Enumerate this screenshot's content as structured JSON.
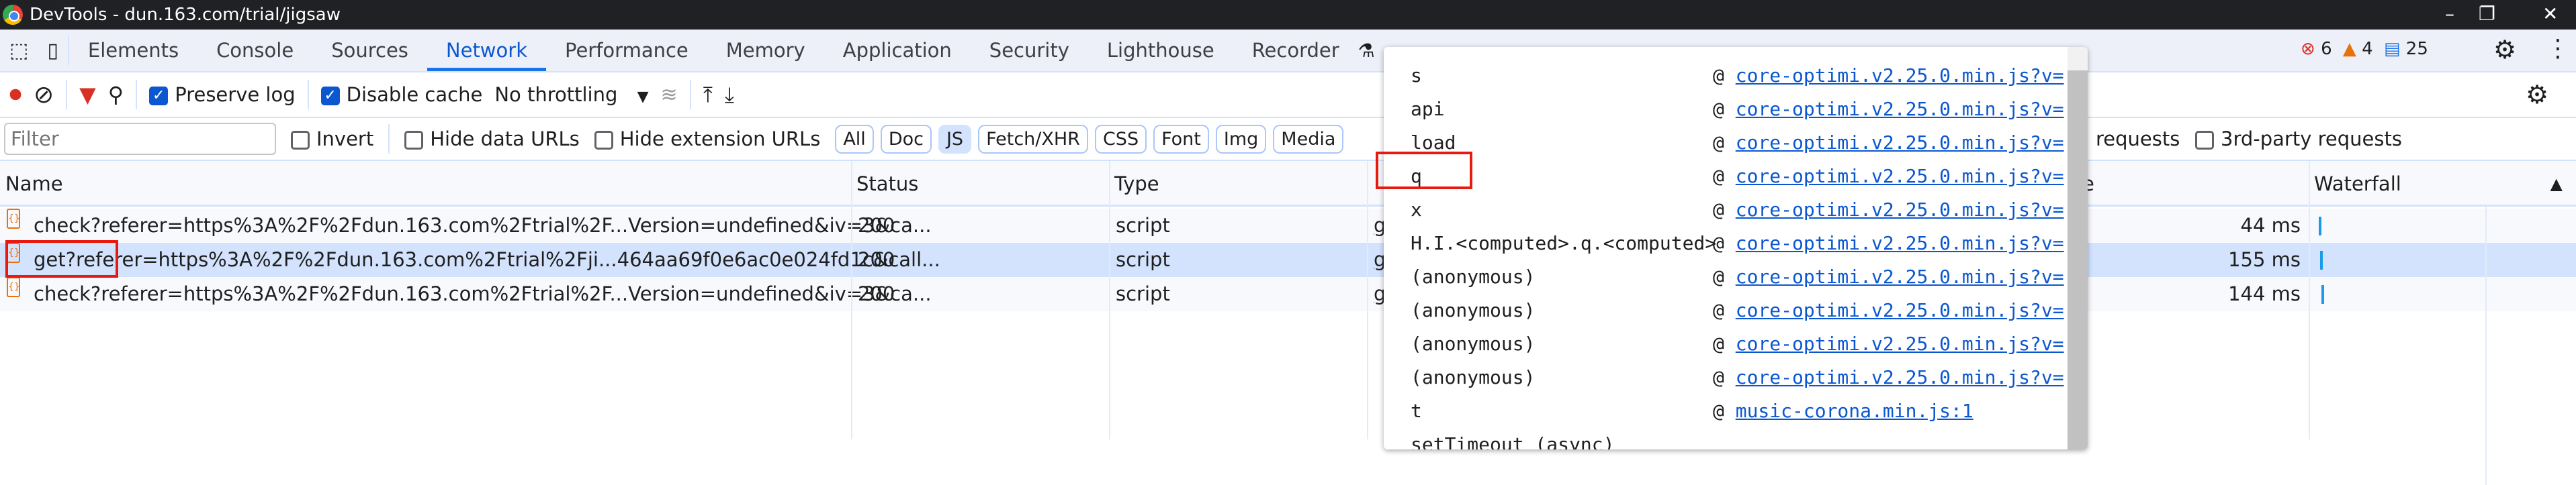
{
  "window": {
    "title": "DevTools - dun.163.com/trial/jigsaw",
    "minimize": "–",
    "restore": "❐",
    "close": "✕"
  },
  "tabs": [
    "Elements",
    "Console",
    "Sources",
    "Network",
    "Performance",
    "Memory",
    "Application",
    "Security",
    "Lighthouse",
    "Recorder"
  ],
  "active_tab": "Network",
  "badges": {
    "errors": "6",
    "warnings": "4",
    "messages": "25"
  },
  "toolbar": {
    "preserve_log": "Preserve log",
    "preserve_log_checked": true,
    "disable_cache": "Disable cache",
    "disable_cache_checked": true,
    "throttling": "No throttling"
  },
  "filter": {
    "placeholder": "Filter",
    "invert": "Invert",
    "hide_data_urls": "Hide data URLs",
    "hide_extension_urls": "Hide extension URLs",
    "types": [
      "All",
      "Doc",
      "JS",
      "Fetch/XHR",
      "CSS",
      "Font",
      "Img",
      "Media"
    ],
    "active_type": "JS",
    "requests_suffix": "requests",
    "third_party": "3rd-party requests"
  },
  "columns": {
    "name": "Name",
    "status": "Status",
    "type": "Type",
    "time_partial": "e",
    "waterfall": "Waterfall"
  },
  "rows": [
    {
      "name": "check?referer=https%3A%2F%2Fdun.163.com%2Ftrial%2F...Version=undefined&iv=3&ca...",
      "status": "200",
      "type": "script",
      "initiator": "g",
      "time": "44 ms"
    },
    {
      "name": "get?referer=https%3A%2F%2Fdun.163.com%2Ftrial%2Fji...464aa69f0e6ac0e024fd1c&call...",
      "status": "200",
      "type": "script",
      "initiator": "g",
      "time": "155 ms",
      "selected": true
    },
    {
      "name": "check?referer=https%3A%2F%2Fdun.163.com%2Ftrial%2F...Version=undefined&iv=3&ca...",
      "status": "200",
      "type": "script",
      "initiator": "g",
      "time": "144 ms"
    }
  ],
  "stack": [
    {
      "fn": "s",
      "loc": "core-optimi.v2.25.0.min.js?v="
    },
    {
      "fn": "api",
      "loc": "core-optimi.v2.25.0.min.js?v="
    },
    {
      "fn": "load",
      "loc": "core-optimi.v2.25.0.min.js?v="
    },
    {
      "fn": "q",
      "loc": "core-optimi.v2.25.0.min.js?v="
    },
    {
      "fn": "x",
      "loc": "core-optimi.v2.25.0.min.js?v="
    },
    {
      "fn": "H.I.<computed>.q.<computed>",
      "loc": "core-optimi.v2.25.0.min.js?v="
    },
    {
      "fn": "(anonymous)",
      "loc": "core-optimi.v2.25.0.min.js?v="
    },
    {
      "fn": "(anonymous)",
      "loc": "core-optimi.v2.25.0.min.js?v="
    },
    {
      "fn": "(anonymous)",
      "loc": "core-optimi.v2.25.0.min.js?v="
    },
    {
      "fn": "(anonymous)",
      "loc": "core-optimi.v2.25.0.min.js?v="
    },
    {
      "fn": "t",
      "loc": "music-corona.min.js:1"
    },
    {
      "fn": "setTimeout (async)",
      "loc": ""
    }
  ],
  "at": "@",
  "colors": {
    "accent": "#1a73e8",
    "link": "#0b57d0",
    "highlight": "#e8190e",
    "selected_row": "#d3e3fd"
  }
}
